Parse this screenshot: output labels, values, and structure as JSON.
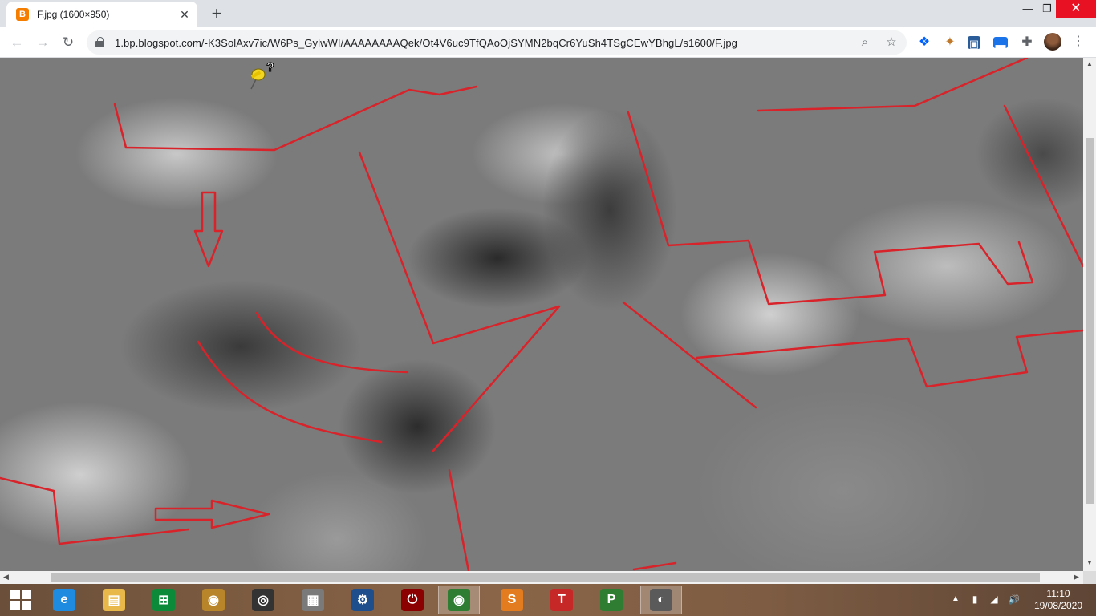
{
  "browser": {
    "tab": {
      "title": "F.jpg (1600×950)",
      "favicon": "B"
    },
    "new_tab": "+",
    "window": {
      "minimize": "—",
      "maximize": "❐",
      "close": "✕"
    },
    "nav": {
      "back": "←",
      "forward": "→",
      "reload": "↻"
    },
    "url": "1bp.blogspot.com/-K3SolAxv7ic/W6Ps_GylwWI/AAAAAAAAQek/Ot4V6uc9TfQAoOjSYMN2bqCr6YuSh4TSgCEwYBhgL/s1600/F.jpg",
    "url_display": "1.bp.blogspot.com/-K3SolAxv7ic/W6Ps_GylwWI/AAAAAAAAQek/Ot4V6uc9TfQAoOjSYMN2bqCr6YuSh4TSgCEwYBhgL/s1600/F.jpg",
    "icons": {
      "zoom": "search-icon",
      "bookmark": "star-icon",
      "extensions": [
        "dropbox-icon",
        "tools-icon",
        "app-icon",
        "calendar-icon",
        "puzzle-icon"
      ],
      "menu": "more-vertical-icon"
    },
    "glyphs": {
      "zoom": "⌕",
      "star": "☆",
      "dropbox": "❖",
      "tools": "✦",
      "puzzle": "✚",
      "menu": "⋮",
      "blue1": "▣",
      "blue2": "▬"
    }
  },
  "image": {
    "marker": "pushpin-with-question-icon",
    "marker_glyph": "?",
    "annotation_color": "#d8232a"
  },
  "taskbar": {
    "apps": [
      {
        "name": "internet-explorer",
        "glyph": "e",
        "color": "#1e8ae0"
      },
      {
        "name": "file-explorer",
        "glyph": "▤",
        "color": "#e8b84a"
      },
      {
        "name": "store",
        "glyph": "⊞",
        "color": "#0b8a3a"
      },
      {
        "name": "app-camera",
        "glyph": "◉",
        "color": "#b9852a"
      },
      {
        "name": "speaker",
        "glyph": "◎",
        "color": "#333333"
      },
      {
        "name": "doc-tool",
        "glyph": "▦",
        "color": "#7a7a7a"
      },
      {
        "name": "settings-app",
        "glyph": "⚙",
        "color": "#1f4e8c"
      },
      {
        "name": "power-app",
        "glyph": "⏻",
        "color": "#8b0000"
      },
      {
        "name": "chrome",
        "glyph": "◉",
        "color": "#2e7d32"
      },
      {
        "name": "app-s",
        "glyph": "S",
        "color": "#e37b1f"
      },
      {
        "name": "app-t",
        "glyph": "T",
        "color": "#c62828"
      },
      {
        "name": "app-p",
        "glyph": "P",
        "color": "#2e7d32"
      },
      {
        "name": "google-earth-pro",
        "glyph": "◐",
        "color": "#5a5a5a"
      }
    ],
    "tray": {
      "chevron": "▲",
      "network_glyph": "▮",
      "signal_glyph": "◢",
      "volume_glyph": "🔊"
    },
    "clock": {
      "time": "11:10",
      "date": "19/08/2020"
    }
  },
  "scrollbars": {
    "up": "▲",
    "down": "▼",
    "left": "◀",
    "right": "▶"
  }
}
